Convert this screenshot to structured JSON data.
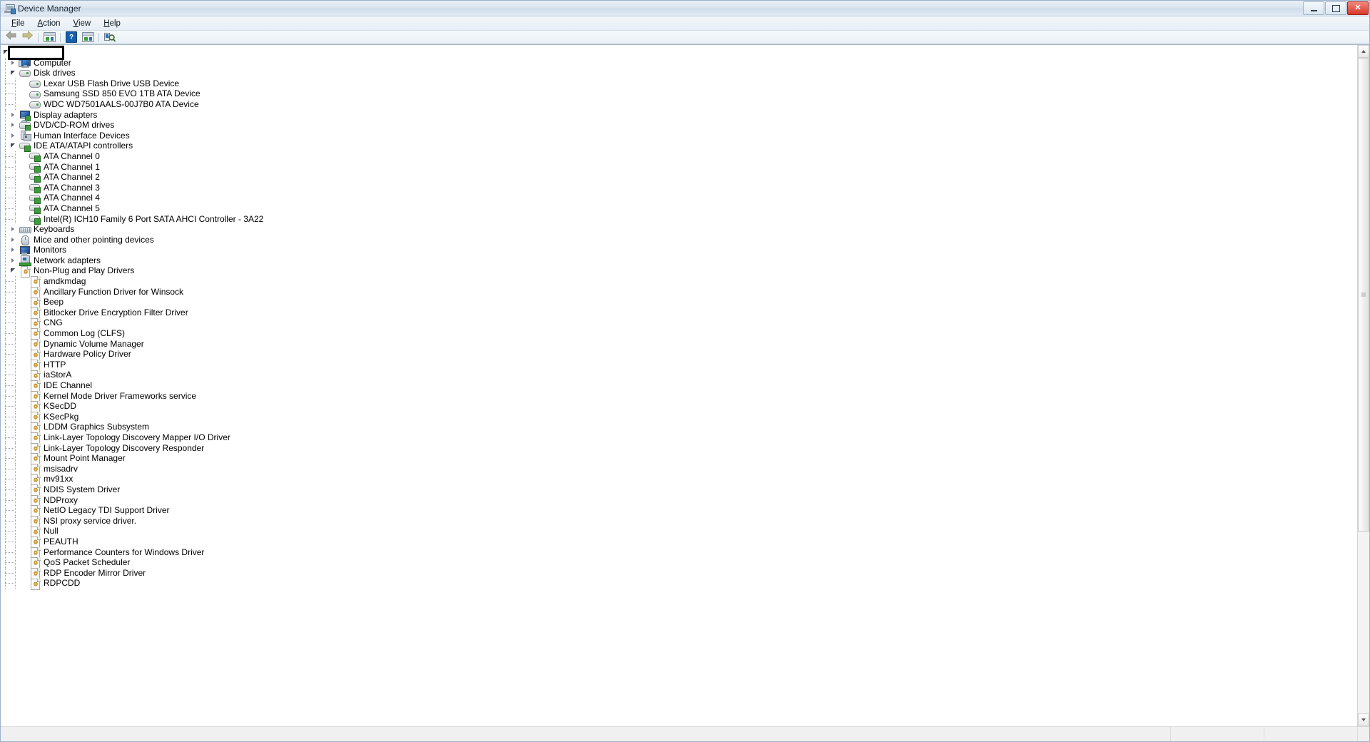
{
  "window": {
    "title": "Device Manager",
    "icon": "device-manager-icon",
    "controls": {
      "minimize": "–",
      "maximize": "❐",
      "close": "✕"
    }
  },
  "menubar": {
    "items": [
      {
        "label": "File",
        "accel": "F"
      },
      {
        "label": "Action",
        "accel": "A"
      },
      {
        "label": "View",
        "accel": "V"
      },
      {
        "label": "Help",
        "accel": "H"
      }
    ]
  },
  "toolbar": {
    "items": [
      {
        "name": "back-button",
        "icon": "back-arrow-icon"
      },
      {
        "name": "forward-button",
        "icon": "forward-arrow-icon"
      },
      {
        "name": "toolbar-separator-1",
        "icon": "separator"
      },
      {
        "name": "properties-button",
        "icon": "properties-icon"
      },
      {
        "name": "toolbar-separator-2",
        "icon": "separator"
      },
      {
        "name": "help-button",
        "icon": "help-icon"
      },
      {
        "name": "update-driver-button",
        "icon": "update-driver-icon"
      },
      {
        "name": "toolbar-separator-3",
        "icon": "separator"
      },
      {
        "name": "scan-hardware-button",
        "icon": "scan-hardware-icon"
      }
    ]
  },
  "tree": {
    "root": {
      "label": "",
      "redacted": true,
      "icon": "computer-root-icon"
    },
    "nodes": [
      {
        "label": "Computer",
        "level": 1,
        "icon": "computer-icon",
        "state": "collapsed"
      },
      {
        "label": "Disk drives",
        "level": 1,
        "icon": "disk-icon",
        "state": "expanded"
      },
      {
        "label": "Lexar USB Flash Drive USB Device",
        "level": 2,
        "icon": "disk-icon",
        "state": "leaf"
      },
      {
        "label": "Samsung SSD 850 EVO 1TB ATA Device",
        "level": 2,
        "icon": "disk-icon",
        "state": "leaf"
      },
      {
        "label": "WDC WD7501AALS-00J7B0 ATA Device",
        "level": 2,
        "icon": "disk-icon",
        "state": "leaf"
      },
      {
        "label": "Display adapters",
        "level": 1,
        "icon": "display-icon",
        "state": "collapsed"
      },
      {
        "label": "DVD/CD-ROM drives",
        "level": 1,
        "icon": "dvd-icon",
        "state": "collapsed"
      },
      {
        "label": "Human Interface Devices",
        "level": 1,
        "icon": "hid-icon",
        "state": "collapsed"
      },
      {
        "label": "IDE ATA/ATAPI controllers",
        "level": 1,
        "icon": "ide-icon",
        "state": "expanded"
      },
      {
        "label": "ATA Channel 0",
        "level": 2,
        "icon": "ide-icon",
        "state": "leaf"
      },
      {
        "label": "ATA Channel 1",
        "level": 2,
        "icon": "ide-icon",
        "state": "leaf"
      },
      {
        "label": "ATA Channel 2",
        "level": 2,
        "icon": "ide-icon",
        "state": "leaf"
      },
      {
        "label": "ATA Channel 3",
        "level": 2,
        "icon": "ide-icon",
        "state": "leaf"
      },
      {
        "label": "ATA Channel 4",
        "level": 2,
        "icon": "ide-icon",
        "state": "leaf"
      },
      {
        "label": "ATA Channel 5",
        "level": 2,
        "icon": "ide-icon",
        "state": "leaf"
      },
      {
        "label": "Intel(R) ICH10 Family 6 Port SATA AHCI Controller - 3A22",
        "level": 2,
        "icon": "ide-icon",
        "state": "leaf"
      },
      {
        "label": "Keyboards",
        "level": 1,
        "icon": "keyboard-icon",
        "state": "collapsed"
      },
      {
        "label": "Mice and other pointing devices",
        "level": 1,
        "icon": "mouse-icon",
        "state": "collapsed"
      },
      {
        "label": "Monitors",
        "level": 1,
        "icon": "monitor-icon",
        "state": "collapsed"
      },
      {
        "label": "Network adapters",
        "level": 1,
        "icon": "network-icon",
        "state": "collapsed"
      },
      {
        "label": "Non-Plug and Play Drivers",
        "level": 1,
        "icon": "driver-icon",
        "state": "expanded"
      },
      {
        "label": "amdkmdag",
        "level": 2,
        "icon": "driver-icon",
        "state": "leaf"
      },
      {
        "label": "Ancillary Function Driver for Winsock",
        "level": 2,
        "icon": "driver-icon",
        "state": "leaf"
      },
      {
        "label": "Beep",
        "level": 2,
        "icon": "driver-icon",
        "state": "leaf"
      },
      {
        "label": "Bitlocker Drive Encryption Filter Driver",
        "level": 2,
        "icon": "driver-icon",
        "state": "leaf"
      },
      {
        "label": "CNG",
        "level": 2,
        "icon": "driver-icon",
        "state": "leaf"
      },
      {
        "label": "Common Log (CLFS)",
        "level": 2,
        "icon": "driver-icon",
        "state": "leaf"
      },
      {
        "label": "Dynamic Volume Manager",
        "level": 2,
        "icon": "driver-icon",
        "state": "leaf"
      },
      {
        "label": "Hardware Policy Driver",
        "level": 2,
        "icon": "driver-icon",
        "state": "leaf"
      },
      {
        "label": "HTTP",
        "level": 2,
        "icon": "driver-icon",
        "state": "leaf"
      },
      {
        "label": "iaStorA",
        "level": 2,
        "icon": "driver-icon",
        "state": "leaf"
      },
      {
        "label": "IDE Channel",
        "level": 2,
        "icon": "driver-icon",
        "state": "leaf"
      },
      {
        "label": "Kernel Mode Driver Frameworks service",
        "level": 2,
        "icon": "driver-icon",
        "state": "leaf"
      },
      {
        "label": "KSecDD",
        "level": 2,
        "icon": "driver-icon",
        "state": "leaf"
      },
      {
        "label": "KSecPkg",
        "level": 2,
        "icon": "driver-icon",
        "state": "leaf"
      },
      {
        "label": "LDDM Graphics Subsystem",
        "level": 2,
        "icon": "driver-icon",
        "state": "leaf"
      },
      {
        "label": "Link-Layer Topology Discovery Mapper I/O Driver",
        "level": 2,
        "icon": "driver-icon",
        "state": "leaf"
      },
      {
        "label": "Link-Layer Topology Discovery Responder",
        "level": 2,
        "icon": "driver-icon",
        "state": "leaf"
      },
      {
        "label": "Mount Point Manager",
        "level": 2,
        "icon": "driver-icon",
        "state": "leaf"
      },
      {
        "label": "msisadrv",
        "level": 2,
        "icon": "driver-icon",
        "state": "leaf"
      },
      {
        "label": "mv91xx",
        "level": 2,
        "icon": "driver-icon",
        "state": "leaf"
      },
      {
        "label": "NDIS System Driver",
        "level": 2,
        "icon": "driver-icon",
        "state": "leaf"
      },
      {
        "label": "NDProxy",
        "level": 2,
        "icon": "driver-icon",
        "state": "leaf"
      },
      {
        "label": "NetIO Legacy TDI Support Driver",
        "level": 2,
        "icon": "driver-icon",
        "state": "leaf"
      },
      {
        "label": "NSI proxy service driver.",
        "level": 2,
        "icon": "driver-icon",
        "state": "leaf"
      },
      {
        "label": "Null",
        "level": 2,
        "icon": "driver-icon",
        "state": "leaf"
      },
      {
        "label": "PEAUTH",
        "level": 2,
        "icon": "driver-icon",
        "state": "leaf"
      },
      {
        "label": "Performance Counters for Windows Driver",
        "level": 2,
        "icon": "driver-icon",
        "state": "leaf"
      },
      {
        "label": "QoS Packet Scheduler",
        "level": 2,
        "icon": "driver-icon",
        "state": "leaf"
      },
      {
        "label": "RDP Encoder Mirror Driver",
        "level": 2,
        "icon": "driver-icon",
        "state": "leaf"
      },
      {
        "label": "RDPCDD",
        "level": 2,
        "icon": "driver-icon",
        "state": "leaf"
      }
    ]
  },
  "scrollbar": {
    "up_icon": "scroll-up-icon",
    "down_icon": "scroll-down-icon",
    "thumb_top_pct": 0,
    "thumb_height_pct": 72
  },
  "statusbar": {
    "text": ""
  },
  "colors": {
    "accent": "#1560ac",
    "driver_gear": "#d9a441",
    "device_green": "#3a9e3a",
    "tree_line": "#9aa5b0",
    "close_button": "#d8392b"
  }
}
